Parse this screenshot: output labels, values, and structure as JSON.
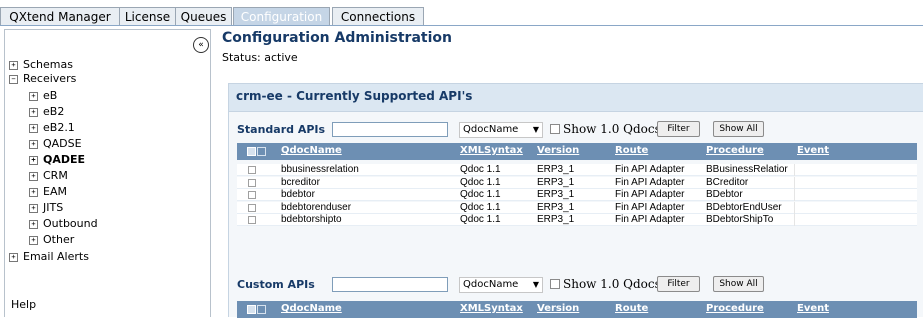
{
  "tabs": [
    {
      "label": "QXtend Manager",
      "active": false
    },
    {
      "label": "License",
      "active": false
    },
    {
      "label": "Queues",
      "active": false
    },
    {
      "label": "Configuration",
      "active": true
    },
    {
      "label": "Connections",
      "active": false
    }
  ],
  "sidebar": {
    "collapse_icon": "double-chevron-left",
    "items": [
      {
        "label": "Schemas",
        "expander": "+"
      },
      {
        "label": "Receivers",
        "expander": "−"
      },
      {
        "label": "eB",
        "expander": "+"
      },
      {
        "label": "eB2",
        "expander": "+"
      },
      {
        "label": "eB2.1",
        "expander": "+"
      },
      {
        "label": "QADSE",
        "expander": "+"
      },
      {
        "label": "QADEE",
        "expander": "+",
        "selected": true
      },
      {
        "label": "CRM",
        "expander": "+"
      },
      {
        "label": "EAM",
        "expander": "+"
      },
      {
        "label": "JITS",
        "expander": "+"
      },
      {
        "label": "Outbound",
        "expander": "+"
      },
      {
        "label": "Other",
        "expander": "+"
      },
      {
        "label": "Email Alerts",
        "expander": "+"
      }
    ],
    "help": "Help"
  },
  "main": {
    "title": "Configuration Administration",
    "status": "Status: active",
    "panel_title": "crm-ee - Currently Supported API's",
    "standard": {
      "label": "Standard APIs",
      "search_value": "",
      "select_value": "QdocName",
      "checkbox_label": "Show 1.0 Qdocs",
      "filter_label": "Filter",
      "show_all_label": "Show All"
    },
    "custom": {
      "label": "Custom APIs",
      "search_value": "",
      "select_value": "QdocName",
      "checkbox_label": "Show 1.0 Qdocs",
      "filter_label": "Filter",
      "show_all_label": "Show All"
    },
    "columns": [
      "QdocName",
      "XMLSyntax",
      "Version",
      "Route",
      "Procedure",
      "Event"
    ],
    "rows": [
      [
        "bbusinessrelation",
        "Qdoc 1.1",
        "ERP3_1",
        "Fin API Adapter",
        "BBusinessRelatior",
        ""
      ],
      [
        "bcreditor",
        "Qdoc 1.1",
        "ERP3_1",
        "Fin API Adapter",
        "BCreditor",
        ""
      ],
      [
        "bdebtor",
        "Qdoc 1.1",
        "ERP3_1",
        "Fin API Adapter",
        "BDebtor",
        ""
      ],
      [
        "bdebtorenduser",
        "Qdoc 1.1",
        "ERP3_1",
        "Fin API Adapter",
        "BDebtorEndUser",
        ""
      ],
      [
        "bdebtorshipto",
        "Qdoc 1.1",
        "ERP3_1",
        "Fin API Adapter",
        "BDebtorShipTo",
        ""
      ]
    ]
  },
  "colors": {
    "header_blue": "#6d8fb3",
    "title_blue": "#173a67",
    "panel_header": "#dbe7f2",
    "active_tab": "#c5d5e6"
  }
}
